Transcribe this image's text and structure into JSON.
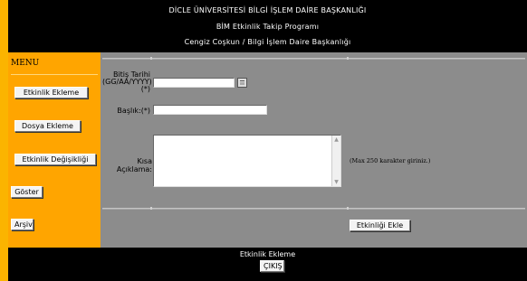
{
  "header": {
    "line1": "DİCLE ÜNİVERSİTESİ BİLGİ İŞLEM DAİRE BAŞKANLIĞI",
    "line2": "BİM Etkinlik Takip Programı",
    "line3": "Cengiz Coşkun / Bilgi İşlem Daire Başkanlığı"
  },
  "sidebar": {
    "title": "MENU",
    "items": [
      {
        "label": "Etkinlik Ekleme"
      },
      {
        "label": "Dosya Ekleme"
      },
      {
        "label": "Etkinlik Değişikliği"
      },
      {
        "label": "Göster"
      },
      {
        "label": "Arşiv"
      }
    ]
  },
  "form": {
    "end_date_label": "Bitiş Tarihi (GG/AA/YYYY) (*)",
    "end_date_value": "",
    "title_label": "Başlık:(*)",
    "title_value": "",
    "description_label": "Kısa Açıklama:",
    "description_value": "",
    "description_hint": "(Max 250 karakter giriniz.)",
    "submit_label": "Etkinliği Ekle",
    "calendar_icon": "calendar-icon"
  },
  "footer": {
    "title": "Etkinlik Ekleme",
    "logout_label": "ÇIKIŞ"
  }
}
